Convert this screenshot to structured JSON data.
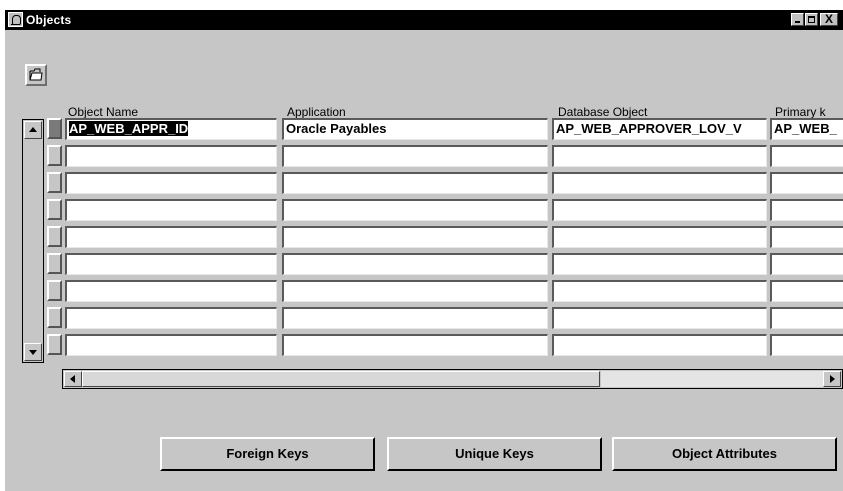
{
  "window": {
    "title": "Objects",
    "close_glyph": "X",
    "icons": {
      "app": "oracle-forms-icon",
      "minimize": "minimize-icon",
      "maximize": "maximize-icon",
      "close": "close-icon"
    }
  },
  "toolbar": {
    "open_icon": "folder-open-icon"
  },
  "table": {
    "columns": [
      "Object Name",
      "Application",
      "Database Object",
      "Primary k"
    ],
    "rows": [
      [
        "AP_WEB_APPR_ID",
        "Oracle Payables",
        "AP_WEB_APPROVER_LOV_V",
        "AP_WEB_"
      ],
      [
        "",
        "",
        "",
        ""
      ],
      [
        "",
        "",
        "",
        ""
      ],
      [
        "",
        "",
        "",
        ""
      ],
      [
        "",
        "",
        "",
        ""
      ],
      [
        "",
        "",
        "",
        ""
      ],
      [
        "",
        "",
        "",
        ""
      ],
      [
        "",
        "",
        "",
        ""
      ],
      [
        "",
        "",
        "",
        ""
      ]
    ],
    "current_row": 0
  },
  "scrollbars": {
    "vertical_icons": [
      "scroll-up-icon",
      "scroll-down-icon"
    ],
    "horizontal_icons": [
      "scroll-left-icon",
      "scroll-right-icon"
    ]
  },
  "buttons": {
    "foreign_keys": "Foreign Keys",
    "unique_keys": "Unique Keys",
    "object_attributes": "Object Attributes"
  },
  "colors": {
    "form_background": "#c6c6c6",
    "titlebar": "#000000",
    "field_background": "#ffffff",
    "selection": "#000000"
  }
}
